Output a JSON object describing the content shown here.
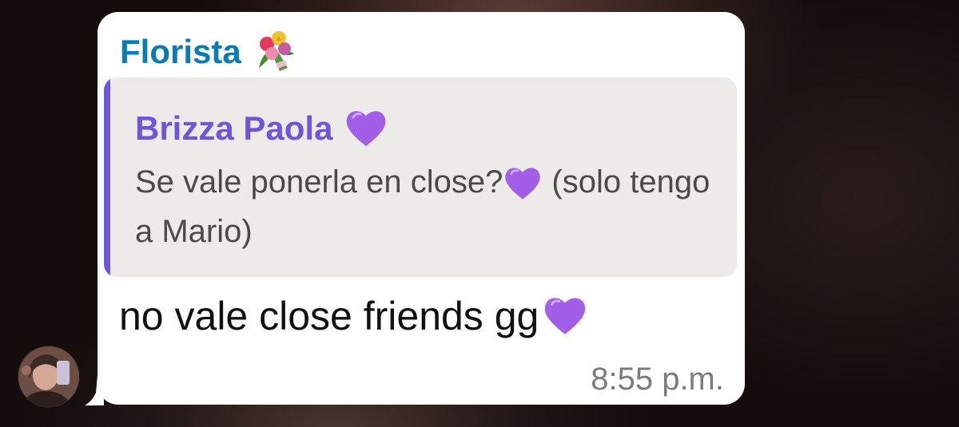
{
  "chat": {
    "avatar_alt": "avatar",
    "sender": {
      "name": "Florista",
      "emoji_icon": "bouquet-icon",
      "color": "#0a7bb3"
    },
    "reply": {
      "name": "Brizza Paola",
      "name_emoji_icon": "purple-heart-icon",
      "text_before": "Se vale ponerla en close?",
      "text_emoji_icon": "purple-heart-icon",
      "text_after": " (solo tengo a Mario)",
      "accent_color": "#6f55d8"
    },
    "message": {
      "text": "no vale close friends gg",
      "emoji_icon": "purple-heart-icon"
    },
    "timestamp": "8:55 p.m."
  }
}
